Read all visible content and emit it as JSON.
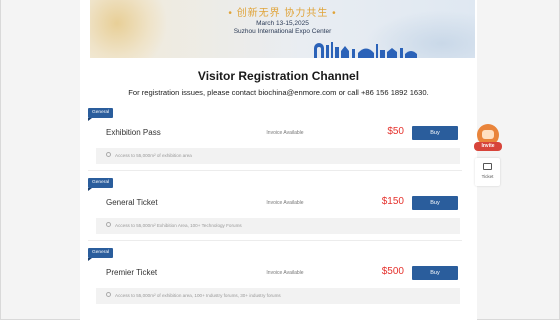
{
  "banner": {
    "slogan": "• 创新无界 协力共生 •",
    "date": "March 13-15,2025",
    "venue": "Suzhou International Expo Center"
  },
  "page": {
    "title": "Visitor Registration Channel",
    "contact": "For registration issues, please contact biochina@enmore.com or call +86 156 1892 1630."
  },
  "tickets": [
    {
      "tag": "General",
      "name": "Exhibition Pass",
      "invoice": "Invoice Available",
      "price": "$50",
      "buy": "Buy",
      "desc": "Access to 55,000m² of exhibition area"
    },
    {
      "tag": "General",
      "name": "General Ticket",
      "invoice": "Invoice Available",
      "price": "$150",
      "buy": "Buy",
      "desc": "Access to 55,000m² Exhibition Area, 100+ Technology Forums"
    },
    {
      "tag": "General",
      "name": "Premier Ticket",
      "invoice": "Invoice Available",
      "price": "$500",
      "buy": "Buy",
      "desc": "Access to 55,000m² of exhibition area, 100+ Industry forums, 30+ industry forums"
    }
  ],
  "float": {
    "invite_label": "Invite",
    "ticket_label": "Ticket",
    "ticket_icon": "ticket-icon",
    "invite_icon": "invite-icon"
  },
  "colors": {
    "accent": "#2a5d9c",
    "price": "#e5322d",
    "slogan": "#e0a43a"
  }
}
